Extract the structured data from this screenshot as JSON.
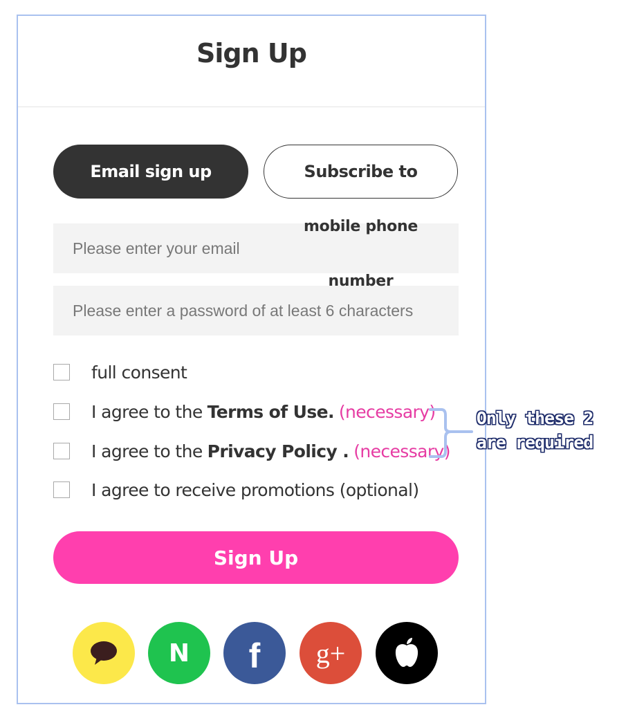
{
  "header": {
    "title": "Sign Up"
  },
  "tabs": {
    "email": "Email sign up",
    "phone": "Subscribe to",
    "phone_overflow_line1": "mobile phone",
    "phone_overflow_line2": "number"
  },
  "form": {
    "email_placeholder": "Please enter your email",
    "password_placeholder": "Please enter a password of at least 6 characters"
  },
  "consents": {
    "all": "full consent",
    "terms_prefix": "I agree to the",
    "terms_bold": "Terms of Use.",
    "terms_tag": "(necessary)",
    "privacy_prefix": "I agree to the",
    "privacy_bold": "Privacy Policy .",
    "privacy_tag": "(necessary)",
    "promotions": "I agree to receive promotions (optional)"
  },
  "submit": {
    "label": "Sign Up"
  },
  "social": [
    {
      "icon": "kakao-icon",
      "color": "#fce84a"
    },
    {
      "icon": "naver-icon",
      "color": "#1fc34f",
      "glyph": "N"
    },
    {
      "icon": "facebook-icon",
      "color": "#3b5998",
      "glyph": "f"
    },
    {
      "icon": "google-plus-icon",
      "color": "#dc4e3a",
      "glyph": "g+"
    },
    {
      "icon": "apple-icon",
      "color": "#000000"
    }
  ],
  "annotation": {
    "line1": "Only these 2",
    "line2": "are required"
  },
  "colors": {
    "accent_pink": "#ff3fae",
    "necessary_pink": "#e63ca3",
    "dark": "#333333",
    "panel_border": "#a9c1ef"
  }
}
